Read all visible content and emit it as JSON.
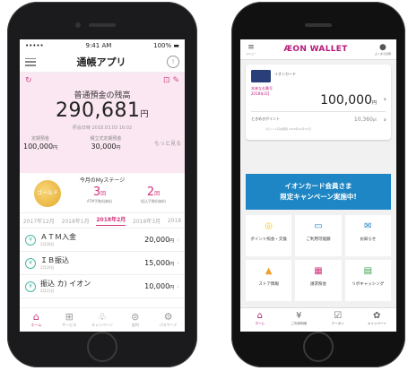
{
  "phone1": {
    "status": {
      "carrier": "••••• ",
      "time": "9:41 AM",
      "battery": "100% ▬"
    },
    "nav": {
      "title": "通帳アプリ",
      "bell": "!"
    },
    "balance": {
      "label": "普通預金の残高",
      "amount": "290,681",
      "unit": "円",
      "date": "照会日時 2018.03.03 16:02",
      "sub": [
        {
          "label": "定期預金",
          "value": "100,000",
          "unit": "円"
        },
        {
          "label": "積立式定期預金",
          "value": "30,000",
          "unit": "円"
        }
      ],
      "more": "もっと見る",
      "icons": {
        "left": "↻",
        "right": "⊡ ✎"
      }
    },
    "stage": {
      "title": "今月のMyステージ",
      "coin": "ゴールド",
      "items": [
        {
          "num": "3",
          "unit": "回",
          "caption": "ATM手数料無料"
        },
        {
          "num": "2",
          "unit": "回",
          "caption": "振込手数料無料"
        }
      ]
    },
    "months": [
      "2017年12月",
      "2018年1月",
      "2018年2月",
      "2018年3月",
      "2018"
    ],
    "active_month_index": 2,
    "transactions": [
      {
        "icon": "¥",
        "name": "ＡＴＭ入金",
        "date": "2月28日",
        "amount": "20,000",
        "unit": "円"
      },
      {
        "icon": "¥",
        "name": "ＩＢ振込",
        "date": "2月20日",
        "amount": "15,000",
        "unit": "円"
      },
      {
        "icon": "¥",
        "name": "振込 カ) イオン",
        "date": "2月15日",
        "amount": "10,000",
        "unit": "円"
      }
    ],
    "tabs": [
      {
        "icon": "⌂",
        "label": "ホーム"
      },
      {
        "icon": "⊞",
        "label": "サービス"
      },
      {
        "icon": "♧",
        "label": "キャンペーン"
      },
      {
        "icon": "⊜",
        "label": "金利"
      },
      {
        "icon": "⚙",
        "label": "パスワード"
      }
    ]
  },
  "phone2": {
    "header": {
      "menu": "≡",
      "menu_label": "メニュー",
      "logo": "ÆON WALLET",
      "user": "●",
      "user_label": "よくある質問"
    },
    "card": {
      "name": "イオンカード",
      "tag1": "本来なお番号",
      "tag2": "2018年3月",
      "amount": "100,000",
      "unit": "円",
      "points_label": "ときめきポイント",
      "points_value": "10,360",
      "points_unit": "pt",
      "points_note": "（ポイント有効期限 2018年12月31日）"
    },
    "banner": {
      "line1": "イオンカード会員さま",
      "line2": "限定キャンペーン実施中!"
    },
    "grid": [
      {
        "icon": "◎",
        "label": "ポイント照会・交換",
        "color": "#f0c530"
      },
      {
        "icon": "▭",
        "label": "ご利用可能額",
        "color": "#1e86c4"
      },
      {
        "icon": "✉",
        "label": "お知らせ",
        "color": "#1e86c4"
      },
      {
        "icon": "▲",
        "label": "ストア情報",
        "color": "#f0a030"
      },
      {
        "icon": "▦",
        "label": "請求照会",
        "color": "#d0337a"
      },
      {
        "icon": "▤",
        "label": "リボキャッシング",
        "color": "#3aa24a"
      }
    ],
    "tabs": [
      {
        "icon": "⌂",
        "label": "ホーム"
      },
      {
        "icon": "¥",
        "label": "ご利用明細"
      },
      {
        "icon": "☑",
        "label": "クーポン"
      },
      {
        "icon": "✿",
        "label": "キャンペーン"
      }
    ]
  }
}
